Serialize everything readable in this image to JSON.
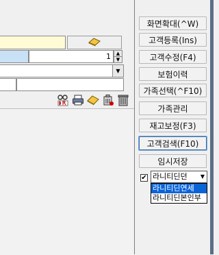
{
  "right_panel": {
    "buttons": [
      {
        "label": "화면확대(^W)"
      },
      {
        "label": "고객등록(Ins)"
      },
      {
        "label": "고객수정(F4)"
      },
      {
        "label": "보험이력"
      },
      {
        "label": "가족선택(^F10)"
      },
      {
        "label": "가족관리"
      },
      {
        "label": "재고보정(F3)"
      },
      {
        "label": "고객검색(F10)"
      },
      {
        "label": "임시저장"
      }
    ],
    "checkbox_mark": "✔",
    "select_value": "라니티딘던",
    "dropdown_options": [
      "라니티딘연세",
      "라니티딘본인부"
    ]
  },
  "form": {
    "quantity_value": "1",
    "spin_up": "▲",
    "spin_down": "▼",
    "combo_arrow": "▼"
  },
  "toolbar_icons": [
    "dr-icon",
    "print-icon",
    "eraser-icon",
    "delete-icon",
    "trash-icon"
  ],
  "colors": {
    "accent_blue": "#0a64d8",
    "yellow_field": "#fffbd6",
    "blue_field": "#c8e1f7"
  }
}
